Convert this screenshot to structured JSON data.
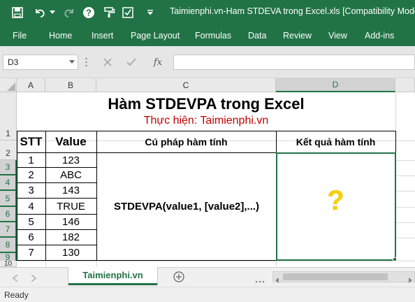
{
  "window": {
    "title": "Taimienphi.vn-Ham STDEVA trong Excel.xls  [Compatibility Mode]"
  },
  "quick_access": {
    "icons": [
      "save-icon",
      "undo-icon",
      "redo-icon",
      "help-icon",
      "format-painter-icon",
      "check-icon",
      "customize-icon"
    ]
  },
  "ribbon": {
    "tabs": [
      "File",
      "Home",
      "Insert",
      "Page Layout",
      "Formulas",
      "Data",
      "Review",
      "View",
      "Add-ins"
    ]
  },
  "formula_bar": {
    "name_box": "D3",
    "fx_label": "fx",
    "content": ""
  },
  "sheet": {
    "columns": [
      "A",
      "B",
      "C",
      "D"
    ],
    "rows": [
      "1",
      "2",
      "3",
      "4",
      "5",
      "6",
      "7",
      "8",
      "9",
      "10"
    ],
    "selected_cell": "D3",
    "title": "Hàm STDEVPA trong Excel",
    "subtitle": "Thực hiện: Taimienphi.vn",
    "headers": {
      "stt": "STT",
      "value": "Value",
      "syntax": "Cú pháp hàm tính",
      "result": "Kết quả hàm tính"
    },
    "data_rows": [
      {
        "stt": "1",
        "value": "123"
      },
      {
        "stt": "2",
        "value": "ABC"
      },
      {
        "stt": "3",
        "value": "143"
      },
      {
        "stt": "4",
        "value": "TRUE"
      },
      {
        "stt": "5",
        "value": "146"
      },
      {
        "stt": "6",
        "value": "182"
      },
      {
        "stt": "7",
        "value": "130"
      }
    ],
    "syntax": "STDEVPA(value1, [value2],...)",
    "result_mark": "?",
    "colors": {
      "accent": "#217346",
      "subtitle": "#c00000",
      "question_mark": "#f5d10a"
    }
  },
  "tabs": {
    "sheet_name": "Taimienphi.vn",
    "add_icon": "plus-circle-icon"
  },
  "status": {
    "text": "Ready"
  }
}
